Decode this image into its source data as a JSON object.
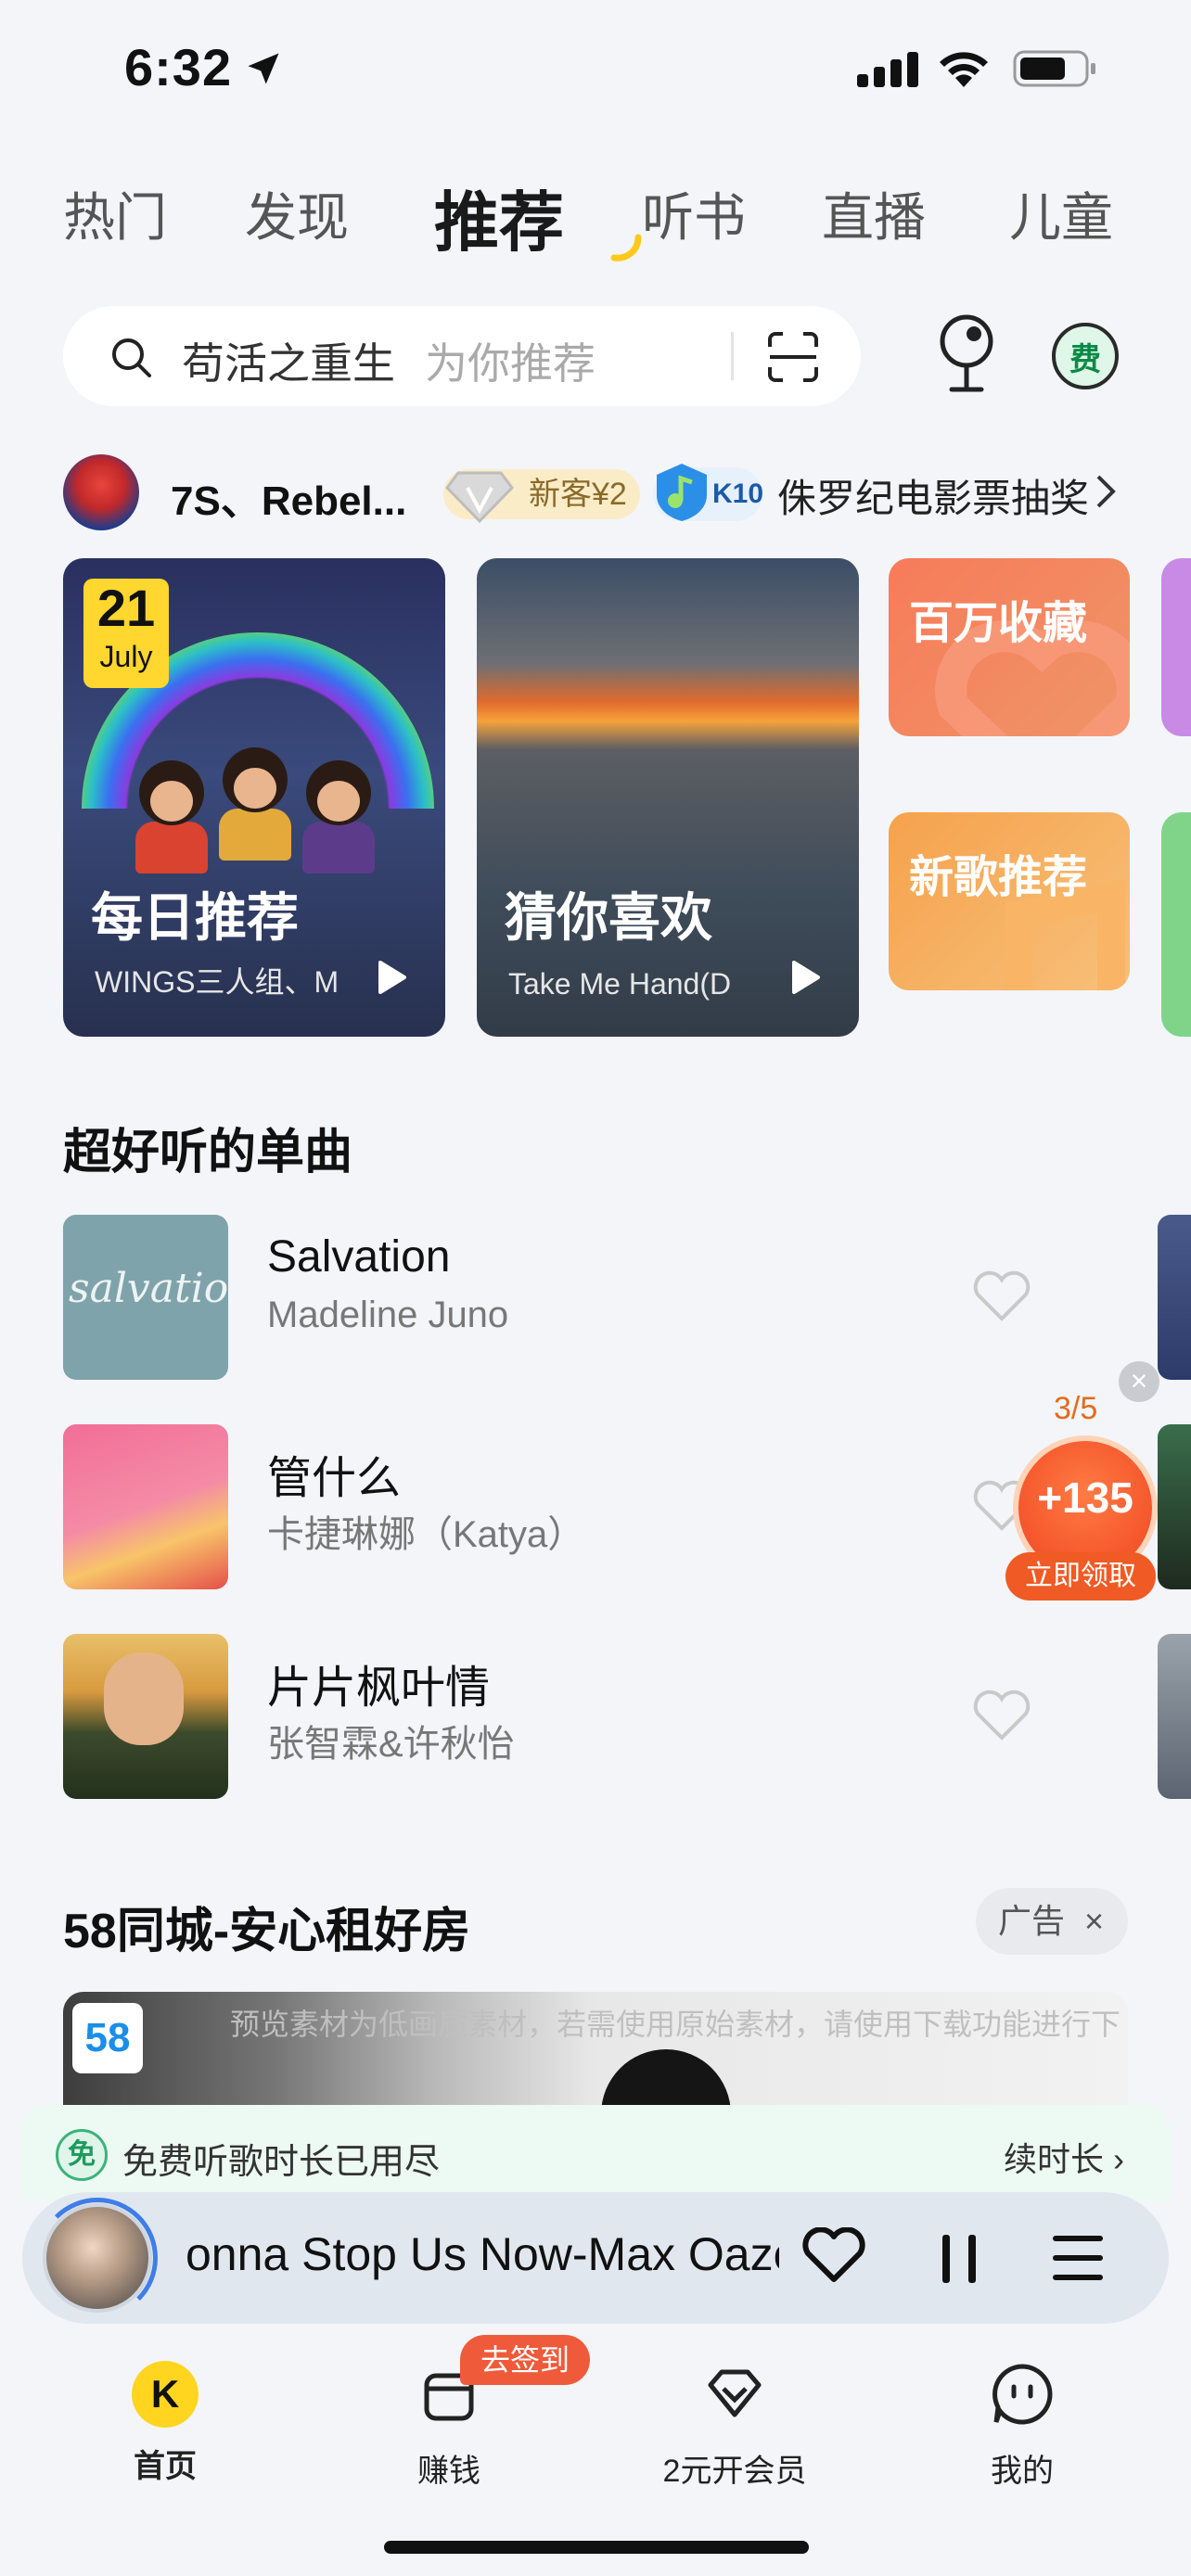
{
  "status_bar": {
    "time": "6:32"
  },
  "top_tabs": [
    {
      "label": "热门",
      "active": false
    },
    {
      "label": "发现",
      "active": false
    },
    {
      "label": "推荐",
      "active": true
    },
    {
      "label": "听书",
      "active": false
    },
    {
      "label": "直播",
      "active": false
    },
    {
      "label": "儿童",
      "active": false
    }
  ],
  "search": {
    "query": "苟活之重生",
    "hint": "为你推荐"
  },
  "fee_label": "费",
  "promo": {
    "name": "7S、Rebel...",
    "new_badge": "新客¥2",
    "level_badge": "K10",
    "prize_text": "侏罗纪电影票抽奖"
  },
  "feature_cards": {
    "daily": {
      "date_day": "21",
      "date_month": "July",
      "title": "每日推荐",
      "subtitle": "WINGS三人组、M"
    },
    "guess": {
      "title": "猜你喜欢",
      "subtitle": "Take Me Hand(D"
    },
    "million": {
      "title": "百万收藏"
    },
    "new_songs": {
      "title": "新歌推荐"
    }
  },
  "songs_section": {
    "title": "超好听的单曲",
    "songs": [
      {
        "title": "Salvation",
        "artist": "Madeline Juno",
        "cover_text": "salvation"
      },
      {
        "title": "管什么",
        "artist": "卡捷琳娜（Katya）"
      },
      {
        "title": "片片枫叶情",
        "artist": "张智霖&许秋怡"
      }
    ]
  },
  "coin_widget": {
    "progress": "3/5",
    "amount": "+135",
    "button": "立即领取"
  },
  "ad_section": {
    "title": "58同城-安心租好房",
    "tag": "广告",
    "logo": "58",
    "watermark": "预览素材为低画质素材，若需使用原始素材，请使用下载功能进行下"
  },
  "quota_bar": {
    "icon": "免",
    "text": "免费听歌时长已用尽",
    "renew": "续时长"
  },
  "mini_player": {
    "title": "onna Stop Us Now-Max Oazo"
  },
  "bottom_tabs": [
    {
      "label": "首页",
      "active": true
    },
    {
      "label": "赚钱",
      "active": false
    },
    {
      "label": "2元开会员",
      "active": false
    },
    {
      "label": "我的",
      "active": false
    }
  ],
  "checkin_badge": "去签到",
  "colors": {
    "accent_yellow": "#ffd51f",
    "coin_orange": "#f05a24",
    "background": "#f3f5f9"
  }
}
